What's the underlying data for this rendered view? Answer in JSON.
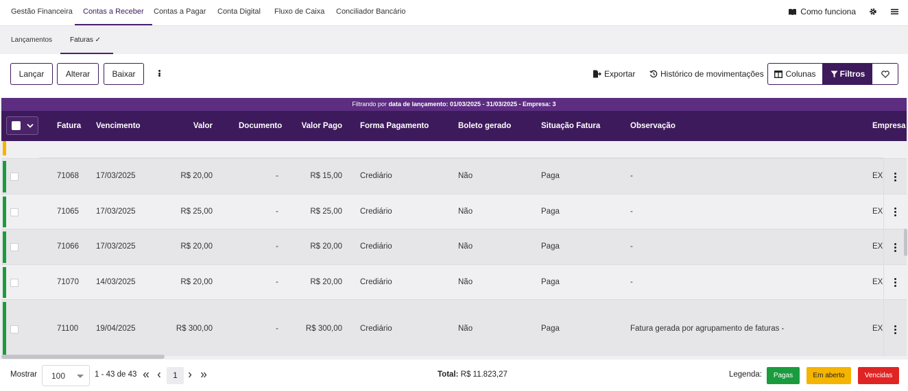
{
  "top_nav": {
    "tabs": [
      "Gestão Financeira",
      "Contas a Receber",
      "Contas a Pagar",
      "Conta Digital",
      "Fluxo de Caixa",
      "Conciliador Bancário"
    ],
    "active_tab": "Contas a Receber",
    "how_it_works": "Como funciona"
  },
  "sub_nav": {
    "tabs": [
      "Lançamentos",
      "Faturas ✓"
    ],
    "active_tab": "Faturas ✓"
  },
  "toolbar": {
    "launch": "Lançar",
    "edit": "Alterar",
    "settle": "Baixar",
    "export": "Exportar",
    "history": "Histórico de movimentações",
    "columns": "Colunas",
    "filters": "Filtros"
  },
  "filter_banner": {
    "prefix": "Filtrando por ",
    "bold": "data de lançamento: 01/03/2025 - 31/03/2025 - Empresa: 3"
  },
  "table": {
    "headers": {
      "fatura": "Fatura",
      "vencimento": "Vencimento",
      "valor": "Valor",
      "documento": "Documento",
      "valor_pago": "Valor Pago",
      "forma_pagamento": "Forma Pagamento",
      "boleto_gerado": "Boleto gerado",
      "situacao": "Situação Fatura",
      "observacao": "Observação",
      "empresa": "Empresa"
    },
    "rows": [
      {
        "status": "paid",
        "fatura": "71068",
        "vencimento": "17/03/2025",
        "valor": "R$ 20,00",
        "documento": "-",
        "valor_pago": "R$ 15,00",
        "forma": "Crediário",
        "boleto": "Não",
        "situacao": "Paga",
        "observacao": "-",
        "empresa": "EXC"
      },
      {
        "status": "paid",
        "fatura": "71065",
        "vencimento": "17/03/2025",
        "valor": "R$ 25,00",
        "documento": "-",
        "valor_pago": "R$ 25,00",
        "forma": "Crediário",
        "boleto": "Não",
        "situacao": "Paga",
        "observacao": "-",
        "empresa": "EXC"
      },
      {
        "status": "paid",
        "fatura": "71066",
        "vencimento": "17/03/2025",
        "valor": "R$ 20,00",
        "documento": "-",
        "valor_pago": "R$ 20,00",
        "forma": "Crediário",
        "boleto": "Não",
        "situacao": "Paga",
        "observacao": "-",
        "empresa": "EXC"
      },
      {
        "status": "paid",
        "fatura": "71070",
        "vencimento": "14/03/2025",
        "valor": "R$ 20,00",
        "documento": "-",
        "valor_pago": "R$ 20,00",
        "forma": "Crediário",
        "boleto": "Não",
        "situacao": "Paga",
        "observacao": "-",
        "empresa": "EXC"
      },
      {
        "status": "paid",
        "fatura": "71100",
        "vencimento": "19/04/2025",
        "valor": "R$ 300,00",
        "documento": "-",
        "valor_pago": "R$ 300,00",
        "forma": "Crediário",
        "boleto": "Não",
        "situacao": "Paga",
        "observacao": "Fatura gerada por agrupamento de faturas -",
        "empresa": "EXC"
      }
    ]
  },
  "footer": {
    "show_label": "Mostrar",
    "page_size": "100",
    "range": "1 - 43 de 43",
    "current_page": "1",
    "total_label": "Total:",
    "total_value": "R$ 11.823,27",
    "legend_label": "Legenda:",
    "legend": {
      "paid": "Pagas",
      "open": "Em aberto",
      "overdue": "Vencidas"
    }
  },
  "colors": {
    "brand_purple": "#3d1a5b",
    "banner_purple": "#5c2d80",
    "paid_green": "#1a9c3e",
    "open_yellow": "#f5b400",
    "overdue_red": "#e02424"
  },
  "icons": {
    "how_it_works": "book-icon",
    "settings": "gear-icon",
    "menu": "hamburger-icon",
    "export": "export-icon",
    "history": "history-icon",
    "columns": "columns-icon",
    "filters": "funnel-icon",
    "favorite": "heart-icon",
    "more": "kebab-icon"
  }
}
